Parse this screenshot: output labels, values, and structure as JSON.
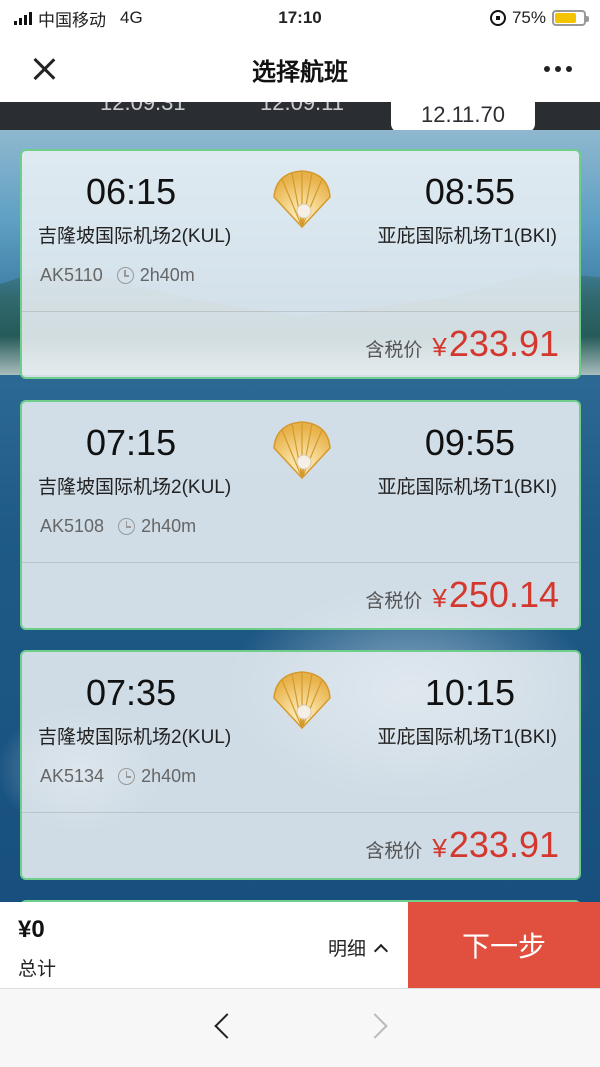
{
  "status_bar": {
    "carrier": "中国移动",
    "network": "4G",
    "time": "17:10",
    "battery": "75%",
    "battery_level": 0.75,
    "battery_color": "#f5c400"
  },
  "header": {
    "title": "选择航班",
    "close_icon": "close-icon",
    "more_icon": "more-icon"
  },
  "date_tabs": [
    {
      "label": "12.09.31",
      "active": false
    },
    {
      "label": "12.09.11",
      "active": false
    },
    {
      "label": "12.11.70",
      "active": true
    }
  ],
  "flights": [
    {
      "dep_time": "06:15",
      "dep_airport": "吉隆坡国际机场2(KUL)",
      "arr_time": "08:55",
      "arr_airport": "亚庇国际机场T1(BKI)",
      "flight_no": "AK5110",
      "duration": "2h40m",
      "price_label": "含税价",
      "currency": "¥",
      "price": "233.91"
    },
    {
      "dep_time": "07:15",
      "dep_airport": "吉隆坡国际机场2(KUL)",
      "arr_time": "09:55",
      "arr_airport": "亚庇国际机场T1(BKI)",
      "flight_no": "AK5108",
      "duration": "2h40m",
      "price_label": "含税价",
      "currency": "¥",
      "price": "250.14"
    },
    {
      "dep_time": "07:35",
      "dep_airport": "吉隆坡国际机场2(KUL)",
      "arr_time": "10:15",
      "arr_airport": "亚庇国际机场T1(BKI)",
      "flight_no": "AK5134",
      "duration": "2h40m",
      "price_label": "含税价",
      "currency": "¥",
      "price": "233.91"
    }
  ],
  "bottom_bar": {
    "total_amount": "¥0",
    "total_label": "总计",
    "detail_label": "明细",
    "next_label": "下一步"
  },
  "colors": {
    "accent_red": "#e1503f",
    "price_red": "#d4372d",
    "card_border": "#6fcf8a",
    "tab_strip": "#2a2e33"
  }
}
